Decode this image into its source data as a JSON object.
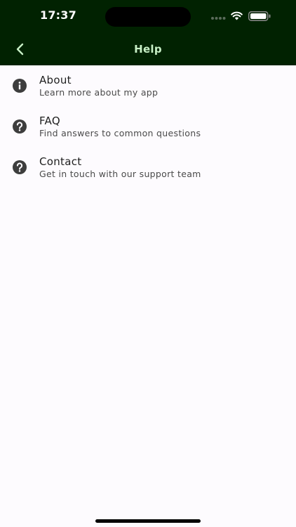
{
  "status_bar": {
    "time": "17:37"
  },
  "nav": {
    "title": "Help",
    "back_icon": "chevron-left-icon"
  },
  "help_items": [
    {
      "title": "About",
      "subtitle": "Learn more about my app",
      "icon": "info-icon"
    },
    {
      "title": "FAQ",
      "subtitle": "Find answers to common questions",
      "icon": "question-icon"
    },
    {
      "title": "Contact",
      "subtitle": "Get in touch with our support team",
      "icon": "question-icon"
    }
  ],
  "colors": {
    "header_background": "#012201",
    "title_text": "#c7efc5",
    "page_background": "#fdfbfe",
    "icon": "#3d3d3d"
  }
}
